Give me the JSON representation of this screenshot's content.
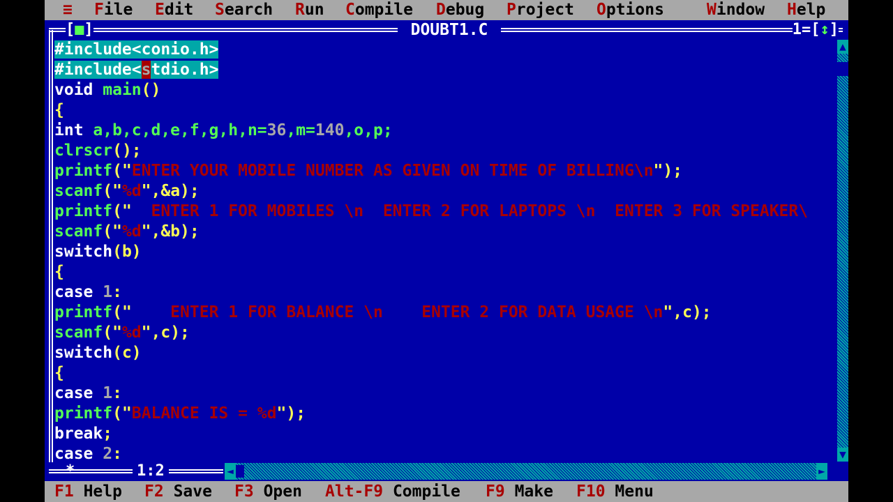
{
  "menu": {
    "system_icon": "≡",
    "items": [
      {
        "hot": "F",
        "rest": "ile"
      },
      {
        "hot": "E",
        "rest": "dit"
      },
      {
        "hot": "S",
        "rest": "earch"
      },
      {
        "hot": "R",
        "rest": "un"
      },
      {
        "hot": "C",
        "rest": "ompile"
      },
      {
        "hot": "D",
        "rest": "ebug"
      },
      {
        "hot": "P",
        "rest": "roject"
      },
      {
        "hot": "O",
        "rest": "ptions"
      },
      {
        "hot": "W",
        "rest": "indow"
      },
      {
        "hot": "H",
        "rest": "elp"
      }
    ]
  },
  "window": {
    "title": "DOUBT1.C",
    "close_left": "[",
    "close_dot": "■",
    "close_right": "]",
    "number": "1=[",
    "zoom_icon": "↕",
    "number_close": "]"
  },
  "code": {
    "l1": "#include<conio.h>",
    "l2a": "#include<",
    "l2b": "s",
    "l2c": "tdio.h>",
    "l3a": "void ",
    "l3b": "main",
    "l3c": "()",
    "l4": "{",
    "l5a": "int ",
    "l5b": "a,b,c,d,e,f,g,h,n=",
    "l5c": "36",
    "l5d": ",m=",
    "l5e": "140",
    "l5f": ",o,p;",
    "l6a": "clrscr",
    "l6b": "();",
    "l7a": "printf",
    "l7b": "(\"",
    "l7c": "ENTER YOUR MOBILE NUMBER AS GIVEN ON TIME OF BILLING\\n",
    "l7d": "\");",
    "l8a": "scanf",
    "l8b": "(\"",
    "l8c": "%d",
    "l8d": "\",&a);",
    "l9a": "printf",
    "l9b": "(\"",
    "l9c": "  ENTER 1 FOR MOBILES \\n  ENTER 2 FOR LAPTOPS \\n  ENTER 3 FOR SPEAKER\\",
    "l10a": "scanf",
    "l10b": "(\"",
    "l10c": "%d",
    "l10d": "\",&b);",
    "l11a": "switch",
    "l11b": "(b)",
    "l12": "{",
    "l13a": "case ",
    "l13b": "1",
    "l13c": ":",
    "l14a": "printf",
    "l14b": "(\"",
    "l14c": "    ENTER 1 FOR BALANCE \\n    ENTER 2 FOR DATA USAGE \\n",
    "l14d": "\",c);",
    "l15a": "scanf",
    "l15b": "(\"",
    "l15c": "%d",
    "l15d": "\",c);",
    "l16a": "switch",
    "l16b": "(c)",
    "l17": "{",
    "l18a": "case ",
    "l18b": "1",
    "l18c": ":",
    "l19a": "printf",
    "l19b": "(\"",
    "l19c": "BALANCE IS = %d",
    "l19d": "\");",
    "l20a": "break",
    "l20b": ";",
    "l21a": "case ",
    "l21b": "2",
    "l21c": ":"
  },
  "status": {
    "marker": "*",
    "position": "1:2"
  },
  "scroll_icons": {
    "up": "▲",
    "down": "▼",
    "left": "◄",
    "right": "►"
  },
  "fkeys": [
    {
      "key": "F1",
      "label": "Help"
    },
    {
      "key": "F2",
      "label": "Save"
    },
    {
      "key": "F3",
      "label": "Open"
    },
    {
      "key": "Alt-F9",
      "label": "Compile"
    },
    {
      "key": "F9",
      "label": "Make"
    },
    {
      "key": "F10",
      "label": "Menu"
    }
  ],
  "colors": {
    "editor_bg": "#0000a8",
    "menu_bg": "#a8a8a8",
    "hotkey": "#a80000",
    "keyword": "#ffffff",
    "identifier": "#55ff55",
    "punct": "#ffff55",
    "string": "#a80000",
    "selection": "#00a8a8"
  }
}
